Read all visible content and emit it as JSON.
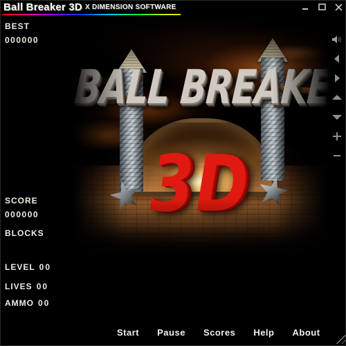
{
  "window": {
    "title": "Ball Breaker 3D",
    "subtitle": "X DIMENSION SOFTWARE",
    "controls": {
      "minimize": "minimize-button",
      "maximize": "maximize-button",
      "close": "close-button"
    }
  },
  "status": {
    "best_label": "BEST",
    "best_value": "000000",
    "score_label": "SCORE",
    "score_value": "000000",
    "blocks_label": "BLOCKS",
    "blocks_value": "",
    "level_label": "LEVEL",
    "level_value": "00",
    "lives_label": "LIVES",
    "lives_value": "00",
    "ammo_label": "AMMO",
    "ammo_value": "00"
  },
  "splash": {
    "wordmark": "BALL BREAKER",
    "logo": "3D"
  },
  "toolbar": {
    "buttons": [
      {
        "name": "sound-icon",
        "label": "Sound"
      },
      {
        "name": "arrow-left-icon",
        "label": "Left"
      },
      {
        "name": "arrow-right-icon",
        "label": "Right"
      },
      {
        "name": "arrow-up-icon",
        "label": "Up"
      },
      {
        "name": "arrow-down-icon",
        "label": "Down"
      },
      {
        "name": "plus-icon",
        "label": "Increase"
      },
      {
        "name": "minus-icon",
        "label": "Decrease"
      }
    ]
  },
  "menu": {
    "items": [
      {
        "label": "Start"
      },
      {
        "label": "Pause"
      },
      {
        "label": "Scores"
      },
      {
        "label": "Help"
      },
      {
        "label": "About"
      }
    ]
  },
  "colors": {
    "background": "#000000",
    "text": "#f0ece6",
    "logo_red": "#e01a10",
    "icon_grey": "#8e8e8e"
  }
}
